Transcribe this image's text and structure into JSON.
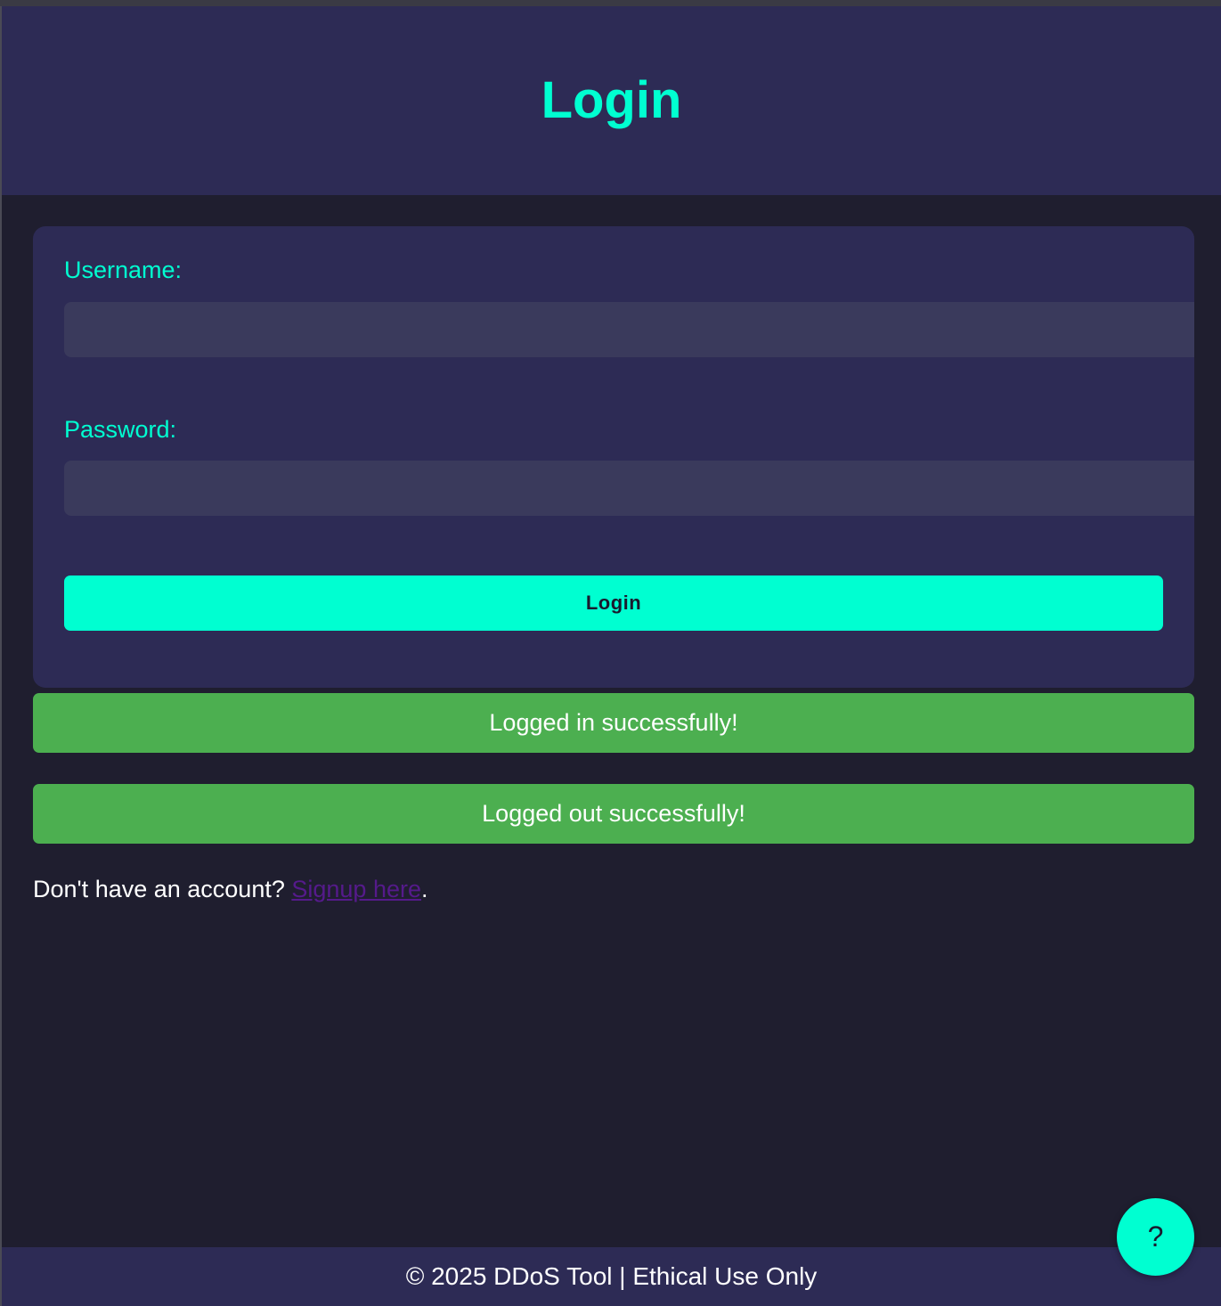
{
  "header": {
    "title": "Login"
  },
  "form": {
    "username_label": "Username:",
    "username_value": "",
    "password_label": "Password:",
    "password_value": "",
    "submit_label": "Login"
  },
  "alerts": [
    {
      "text": "Logged in successfully!"
    },
    {
      "text": "Logged out successfully!"
    }
  ],
  "signup": {
    "prompt": "Don't have an account?",
    "link_text": "Signup here",
    "suffix": "."
  },
  "footer": {
    "text": "© 2025 DDoS Tool | Ethical Use Only"
  },
  "help": {
    "label": "?",
    "icon": "question-icon"
  },
  "colors": {
    "background": "#1f1e2f",
    "panel": "#2d2b55",
    "accent": "#00ffd1",
    "input": "#3a3a5c",
    "success": "#4caf50",
    "link": "#551a8b"
  }
}
